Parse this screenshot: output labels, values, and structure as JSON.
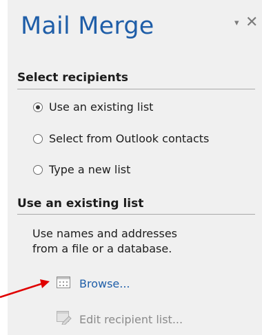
{
  "pane": {
    "title": "Mail Merge",
    "dropdown_glyph": "▾",
    "close_glyph": "✕"
  },
  "select_recipients": {
    "heading": "Select recipients",
    "options": [
      {
        "label": "Use an existing list",
        "selected": true
      },
      {
        "label": "Select from Outlook contacts",
        "selected": false
      },
      {
        "label": "Type a new list",
        "selected": false
      }
    ]
  },
  "existing_list": {
    "heading": "Use an existing list",
    "description_line1": "Use names and addresses",
    "description_line2": "from a file or a database.",
    "browse_label": "Browse...",
    "edit_label": "Edit recipient list..."
  },
  "colors": {
    "accent": "#1f5ea8",
    "annotation_arrow": "#e00000",
    "disabled_text": "#8a8a8a"
  },
  "icons": [
    "table-icon",
    "edit-list-icon",
    "close-icon",
    "dropdown-icon"
  ]
}
